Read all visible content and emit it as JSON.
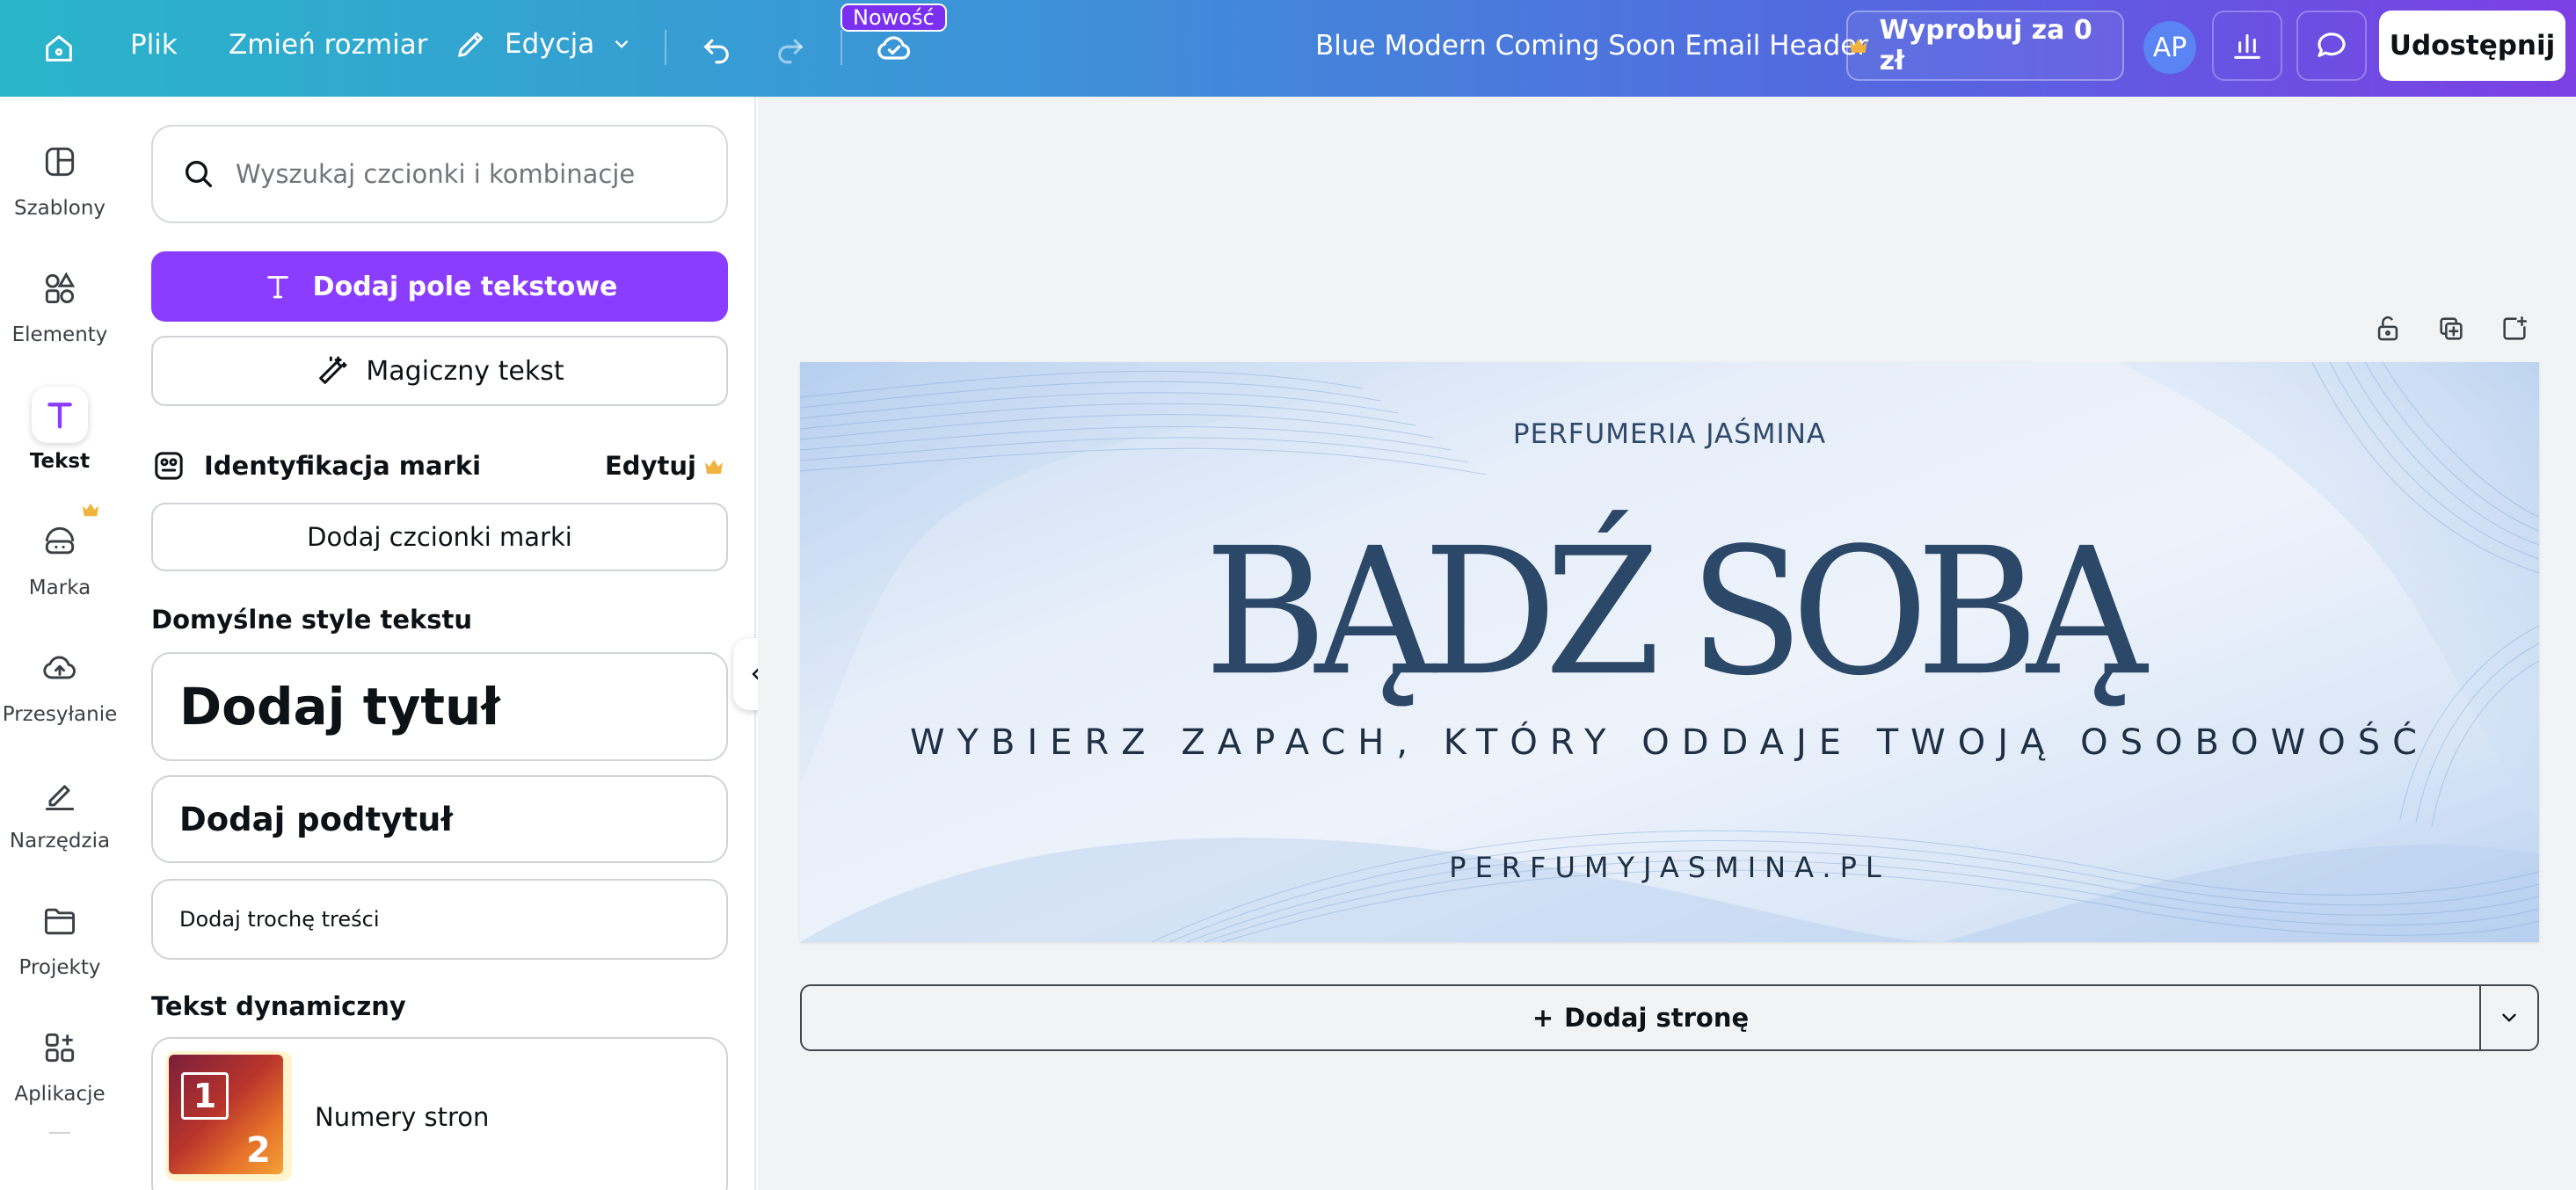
{
  "topbar": {
    "file_label": "Plik",
    "resize_label": "Zmień rozmiar",
    "edit_label": "Edycja",
    "new_badge": "Nowość",
    "document_title": "Blue Modern Coming Soon Email Header",
    "try_label": "Wyprobuj za 0 zł",
    "avatar_initials": "AP",
    "share_label": "Udostępnij"
  },
  "rail": {
    "items": [
      {
        "label": "Szablony",
        "icon": "templates-icon"
      },
      {
        "label": "Elementy",
        "icon": "elements-icon"
      },
      {
        "label": "Tekst",
        "icon": "text-icon",
        "active": true
      },
      {
        "label": "Marka",
        "icon": "brand-icon"
      },
      {
        "label": "Przesyłanie",
        "icon": "upload-cloud-icon"
      },
      {
        "label": "Narzędzia",
        "icon": "tools-icon"
      },
      {
        "label": "Projekty",
        "icon": "folder-icon"
      },
      {
        "label": "Aplikacje",
        "icon": "apps-icon"
      }
    ]
  },
  "panel": {
    "search_placeholder": "Wyszukaj czcionki i kombinacje",
    "add_textbox_label": "Dodaj pole tekstowe",
    "magic_text_label": "Magiczny tekst",
    "brand_identity_label": "Identyfikacja marki",
    "brand_edit_label": "Edytuj",
    "add_brand_fonts_label": "Dodaj czcionki marki",
    "default_styles_title": "Domyślne style tekstu",
    "add_heading_label": "Dodaj tytuł",
    "add_subheading_label": "Dodaj podtytuł",
    "add_body_label": "Dodaj trochę treści",
    "dynamic_text_title": "Tekst dynamiczny",
    "page_numbers_label": "Numery stron",
    "page_numbers_thumb_1": "1",
    "page_numbers_thumb_2": "2"
  },
  "design": {
    "brand": "PERFUMERIA JAŚMINA",
    "headline": "BĄDŹ SOBĄ",
    "subheadline": "WYBIERZ ZAPACH, KTÓRY ODDAJE TWOJĄ OSOBOWOŚĆ",
    "url": "PERFUMYJASMINA.PL"
  },
  "footer": {
    "add_page_label": "Dodaj stronę",
    "add_page_plus": "+"
  },
  "colors": {
    "accent_purple": "#8b3dff",
    "premium_crown": "#f2b33d",
    "design_text": "#2c4868"
  }
}
